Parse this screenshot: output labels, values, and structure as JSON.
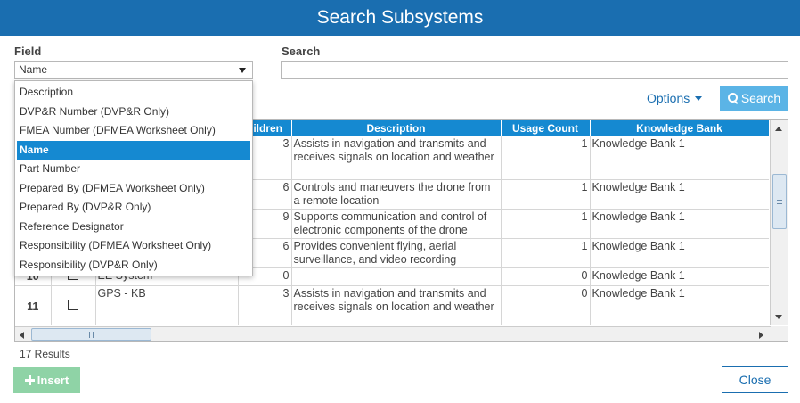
{
  "dialog": {
    "title": "Search Subsystems"
  },
  "field": {
    "label": "Field",
    "selected": "Name"
  },
  "search": {
    "label": "Search",
    "value": "",
    "placeholder": ""
  },
  "options_label": "Options",
  "search_button_label": "Search",
  "dropdown": {
    "options": [
      "Description",
      "DVP&R Number (DVP&R Only)",
      "FMEA Number (DFMEA Worksheet Only)",
      "Name",
      "Part Number",
      "Prepared By (DFMEA Worksheet Only)",
      "Prepared By (DVP&R Only)",
      "Reference Designator",
      "Responsibility (DFMEA Worksheet Only)",
      "Responsibility (DVP&R Only)"
    ],
    "selected_index": 3
  },
  "table": {
    "columns": [
      "",
      "",
      "",
      "hildren",
      "Description",
      "Usage Count",
      "Knowledge Bank"
    ],
    "rows": [
      {
        "row_no": "",
        "name": "",
        "children": "3",
        "description": "Assists in navigation and transmits and receives signals on location and weather",
        "usage": "1",
        "kb": "Knowledge Bank 1"
      },
      {
        "row_no": "",
        "name": "",
        "children": "6",
        "description": "Controls and maneuvers the drone from a remote location",
        "usage": "1",
        "kb": "Knowledge Bank 1"
      },
      {
        "row_no": "",
        "name": "",
        "children": "9",
        "description": "Supports communication and control of electronic components of the drone",
        "usage": "1",
        "kb": "Knowledge Bank 1"
      },
      {
        "row_no": "",
        "name": "",
        "children": "6",
        "description": "Provides convenient flying, aerial surveillance, and video recording",
        "usage": "1",
        "kb": "Knowledge Bank 1"
      },
      {
        "row_no": "10",
        "name": "EE System",
        "children": "0",
        "description": "",
        "usage": "0",
        "kb": "Knowledge Bank 1"
      },
      {
        "row_no": "11",
        "name": "GPS - KB",
        "children": "3",
        "description": "Assists in navigation and transmits and receives signals on location and weather",
        "usage": "0",
        "kb": "Knowledge Bank 1"
      }
    ]
  },
  "results_text": "17 Results",
  "insert_label": "Insert",
  "close_label": "Close",
  "colors": {
    "header": "#1a6eb0",
    "accent": "#1589d1",
    "search_button": "#5bb4e6",
    "insert_button": "#8fd3a6"
  }
}
